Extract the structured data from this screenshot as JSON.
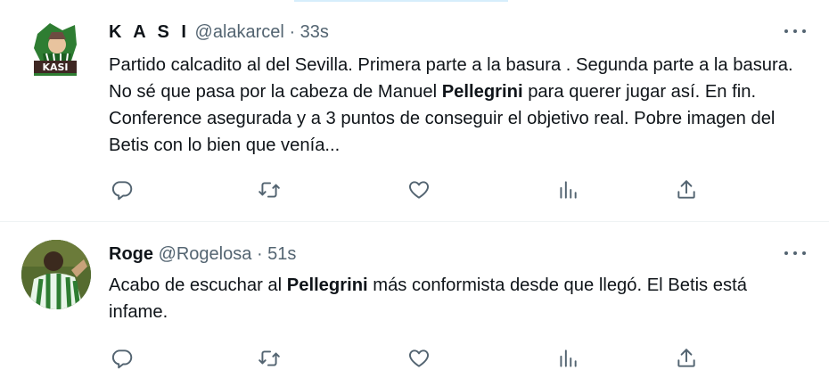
{
  "tweets": [
    {
      "display_name": "K A S I",
      "handle": "@alakarcel",
      "separator": "·",
      "time": "33s",
      "text_parts": [
        "Partido calcadito al del Sevilla. Primera parte a la basura . Segunda parte a la basura. No sé que pasa por la cabeza de Manuel ",
        "Pellegrini",
        " para querer jugar así. En fin. Conference asegurada y a 3 puntos de conseguir el objetivo real. Pobre imagen del Betis con lo bien que venía..."
      ],
      "avatar_text": "KASI"
    },
    {
      "display_name": "Roge",
      "handle": "@Rogelosa",
      "separator": "·",
      "time": "51s",
      "text_parts": [
        "Acabo de escuchar al ",
        "Pellegrini",
        " más conformista desde que llegó. El Betis está infame."
      ]
    }
  ],
  "action_icons": [
    "reply-icon",
    "retweet-icon",
    "like-icon",
    "views-icon",
    "share-icon"
  ],
  "more_icon": "more-dots-icon",
  "colors": {
    "text": "#0f1419",
    "secondary": "#536471",
    "divider": "#eff3f4",
    "avatar_green": "#2f5d2a"
  }
}
